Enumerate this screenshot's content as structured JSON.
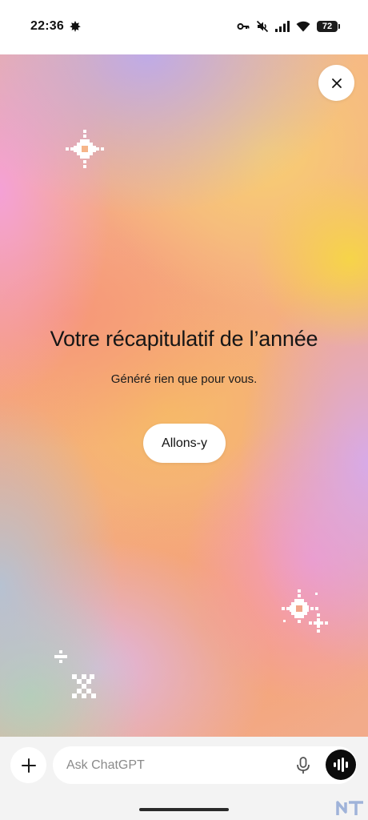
{
  "status_bar": {
    "time": "22:36",
    "battery_level": "72",
    "icons": [
      "leaf-icon",
      "key-icon",
      "mute-icon",
      "signal-icon",
      "wifi-icon",
      "battery-icon"
    ]
  },
  "recap": {
    "title": "Votre récapitulatif de l’année",
    "subtitle": "Généré rien que pour vous.",
    "cta_label": "Allons-y",
    "close_icon": "close-icon"
  },
  "composer": {
    "placeholder": "Ask ChatGPT",
    "value": "",
    "icons": [
      "plus-icon",
      "microphone-icon",
      "voice-mode-icon"
    ]
  },
  "colors": {
    "accent_dark": "#0c0c0c",
    "gradient_yellow": "#f6d646",
    "gradient_orange": "#f5a981",
    "gradient_lavender": "#bcaaec",
    "gradient_pink": "#f4a0da",
    "composer_bg": "#f3f3f3"
  }
}
